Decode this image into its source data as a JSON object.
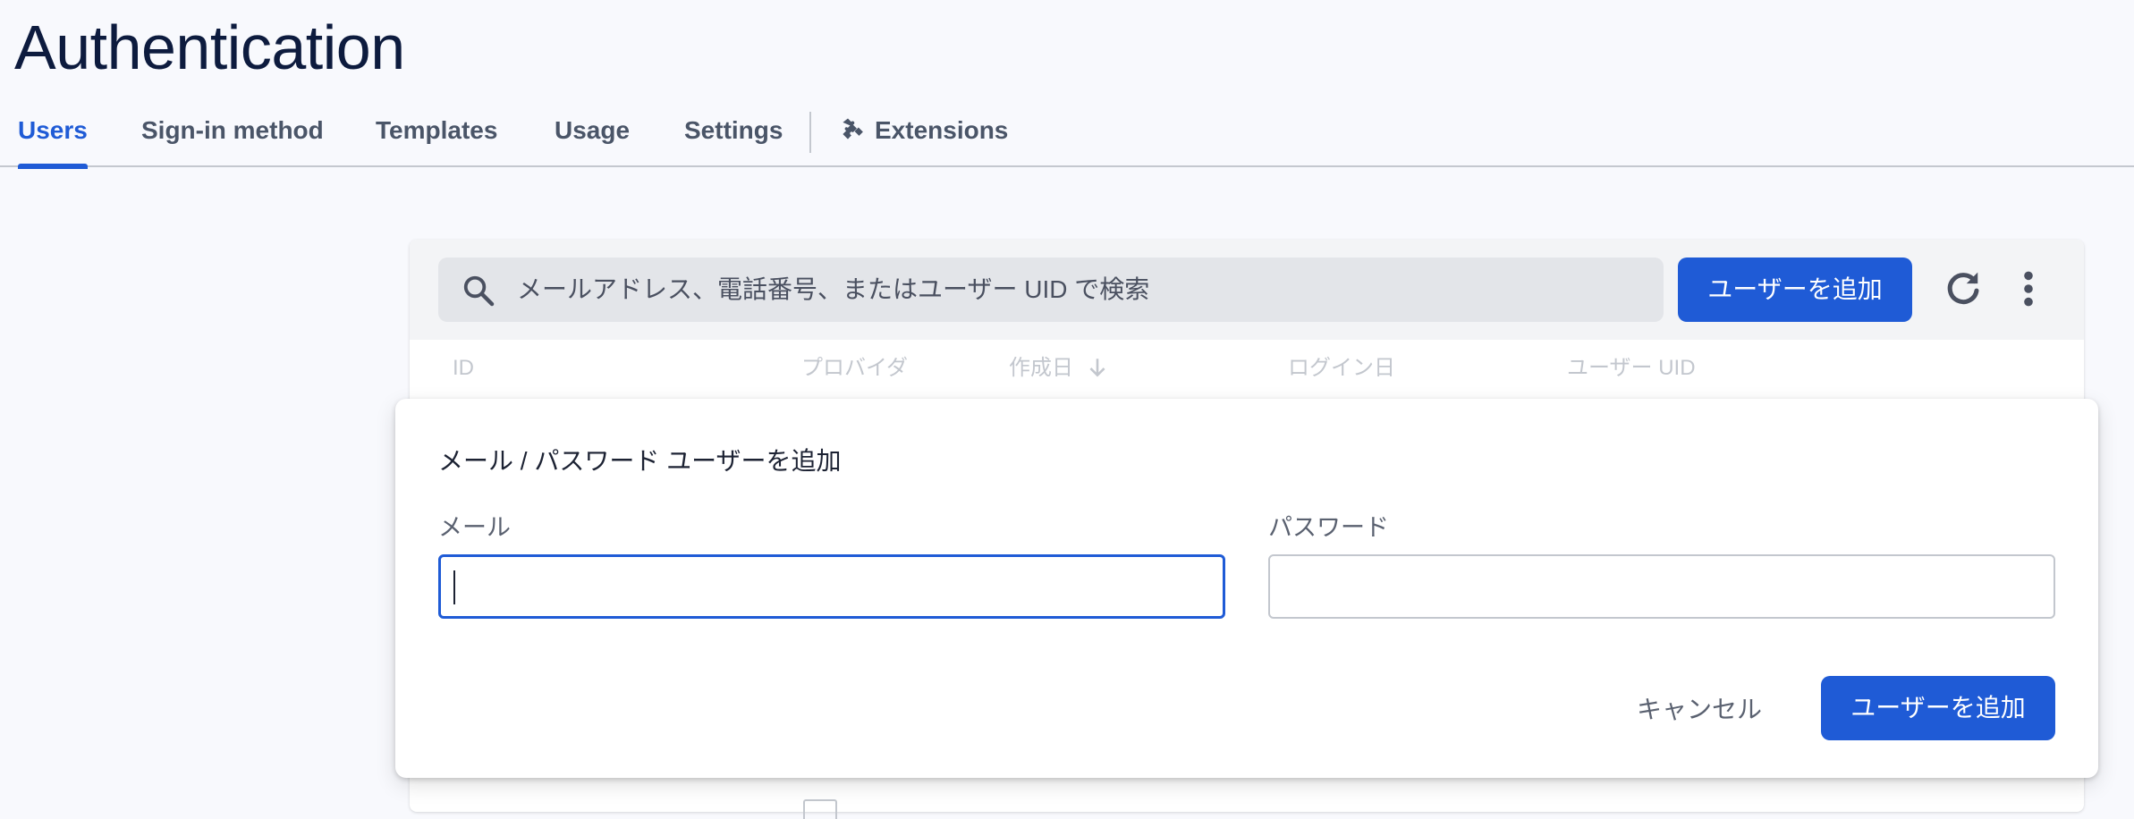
{
  "page": {
    "title": "Authentication"
  },
  "tabs": [
    {
      "label": "Users",
      "active": true
    },
    {
      "label": "Sign-in method",
      "active": false
    },
    {
      "label": "Templates",
      "active": false
    },
    {
      "label": "Usage",
      "active": false
    },
    {
      "label": "Settings",
      "active": false
    },
    {
      "label": "Extensions",
      "active": false,
      "icon": "puzzle-icon"
    }
  ],
  "toolbar": {
    "search_placeholder": "メールアドレス、電話番号、またはユーザー UID で検索",
    "search_icon": "search-icon",
    "add_user_label": "ユーザーを追加",
    "refresh_icon": "refresh-icon",
    "more_icon": "more-vert-icon"
  },
  "table": {
    "columns": [
      {
        "label": "ID"
      },
      {
        "label": "プロバイダ"
      },
      {
        "label": "作成日",
        "sorted": "desc"
      },
      {
        "label": "ログイン日"
      },
      {
        "label": "ユーザー UID"
      }
    ]
  },
  "dialog": {
    "title": "メール / パスワード ユーザーを追加",
    "email_label": "メール",
    "email_value": "",
    "password_label": "パスワード",
    "password_value": "",
    "cancel_label": "キャンセル",
    "submit_label": "ユーザーを追加"
  },
  "colors": {
    "accent": "#1f5bd6",
    "page_background": "#f8f9fd",
    "title": "#0d1b3e"
  }
}
